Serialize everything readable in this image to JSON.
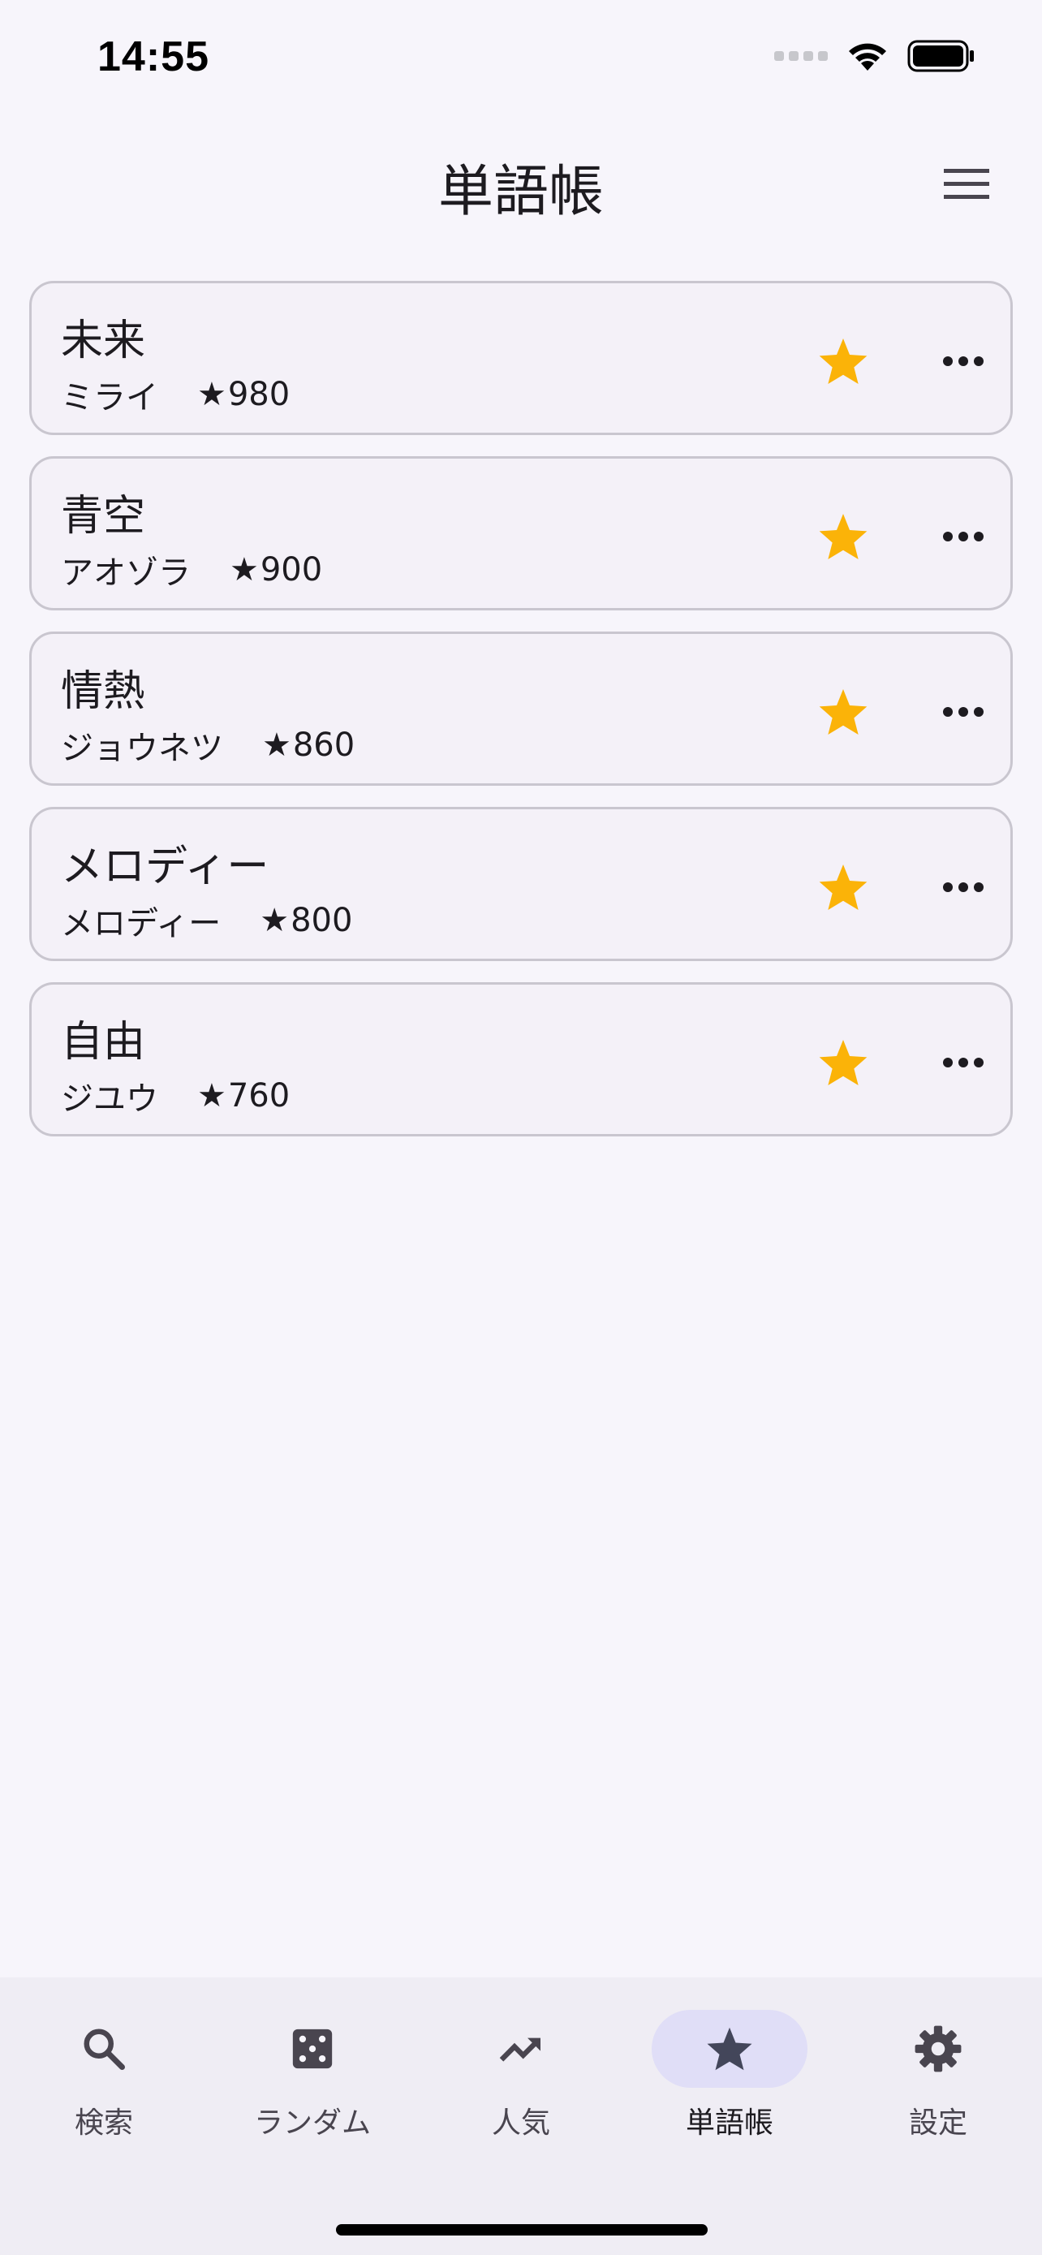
{
  "status_bar": {
    "time": "14:55"
  },
  "header": {
    "title": "単語帳",
    "menu_icon": "hamburger-menu-icon"
  },
  "words": [
    {
      "word": "未来",
      "reading": "ミライ",
      "score": "980"
    },
    {
      "word": "青空",
      "reading": "アオゾラ",
      "score": "900"
    },
    {
      "word": "情熱",
      "reading": "ジョウネツ",
      "score": "860"
    },
    {
      "word": "メロディー",
      "reading": "メロディー",
      "score": "800"
    },
    {
      "word": "自由",
      "reading": "ジユウ",
      "score": "760"
    }
  ],
  "score_prefix": "★",
  "colors": {
    "favorite_star": "#fbb308",
    "nav_active_bg": "#e0def7",
    "background": "#f7f5fb"
  },
  "bottom_nav": {
    "items": [
      {
        "label": "検索",
        "icon": "search-icon"
      },
      {
        "label": "ランダム",
        "icon": "dice-icon"
      },
      {
        "label": "人気",
        "icon": "trending-up-icon"
      },
      {
        "label": "単語帳",
        "icon": "star-icon",
        "active": true
      },
      {
        "label": "設定",
        "icon": "gear-icon"
      }
    ]
  }
}
